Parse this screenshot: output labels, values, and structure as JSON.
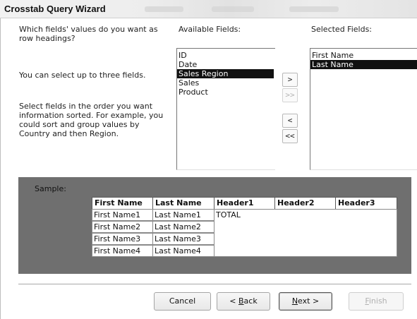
{
  "window": {
    "title": "Crosstab Query Wizard"
  },
  "instructions": {
    "line1": "Which fields' values do you want as",
    "line2": "row headings?",
    "line3": "You can select up to three fields.",
    "line4": "Select fields in the order you want",
    "line5": "information sorted.  For example, you",
    "line6": "could sort and group values by",
    "line7": "Country and then Region."
  },
  "available": {
    "label": "Available Fields:",
    "items": [
      "ID",
      "Date",
      "Sales Region",
      "Sales",
      "Product"
    ],
    "selected_index": 2
  },
  "selected_fields": {
    "label": "Selected Fields:",
    "items": [
      "First Name",
      "Last Name"
    ],
    "selected_index": 1
  },
  "move_buttons": {
    "add": ">",
    "add_all": ">>",
    "remove": "<",
    "remove_all": "<<"
  },
  "sample": {
    "label": "Sample:",
    "headers": [
      "First Name",
      "Last Name",
      "Header1",
      "Header2",
      "Header3"
    ],
    "col1": [
      "First Name1",
      "First Name2",
      "First Name3",
      "First Name4"
    ],
    "col2": [
      "Last Name1",
      "Last Name2",
      "Last Name3",
      "Last Name4"
    ],
    "total": "TOTAL"
  },
  "buttons": {
    "cancel": "Cancel",
    "back_prefix": "< ",
    "back_key": "B",
    "back_rest": "ack",
    "next_key": "N",
    "next_rest": "ext >",
    "finish_key": "F",
    "finish_rest": "inish"
  }
}
